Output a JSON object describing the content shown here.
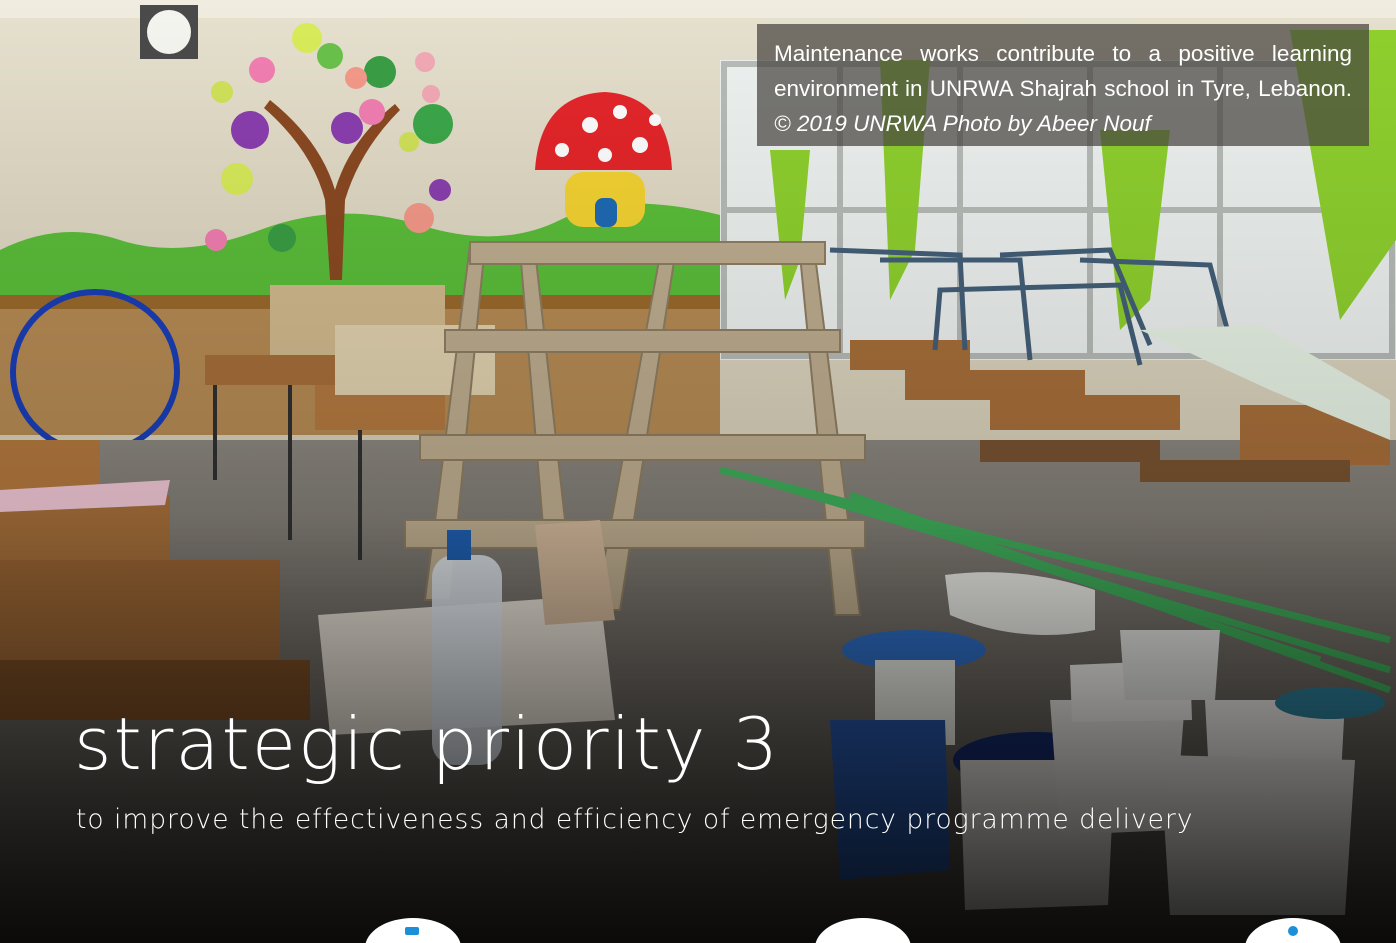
{
  "caption": {
    "text": "Maintenance works contribute to a positive learning environment in UNRWA Shajrah school in Tyre, Lebanon.",
    "credit": "© 2019 UNRWA Photo by Abeer Nouf"
  },
  "title": "strategic priority 3",
  "subtitle": "to improve the effectiveness and efficiency of emergency programme delivery",
  "colors": {
    "accent": "#1c8fd9",
    "text": "#ffffff",
    "caption_bg": "#46443f"
  },
  "icons": {
    "first": "cup-icon",
    "second": "circle-icon",
    "third": "info-icon"
  }
}
